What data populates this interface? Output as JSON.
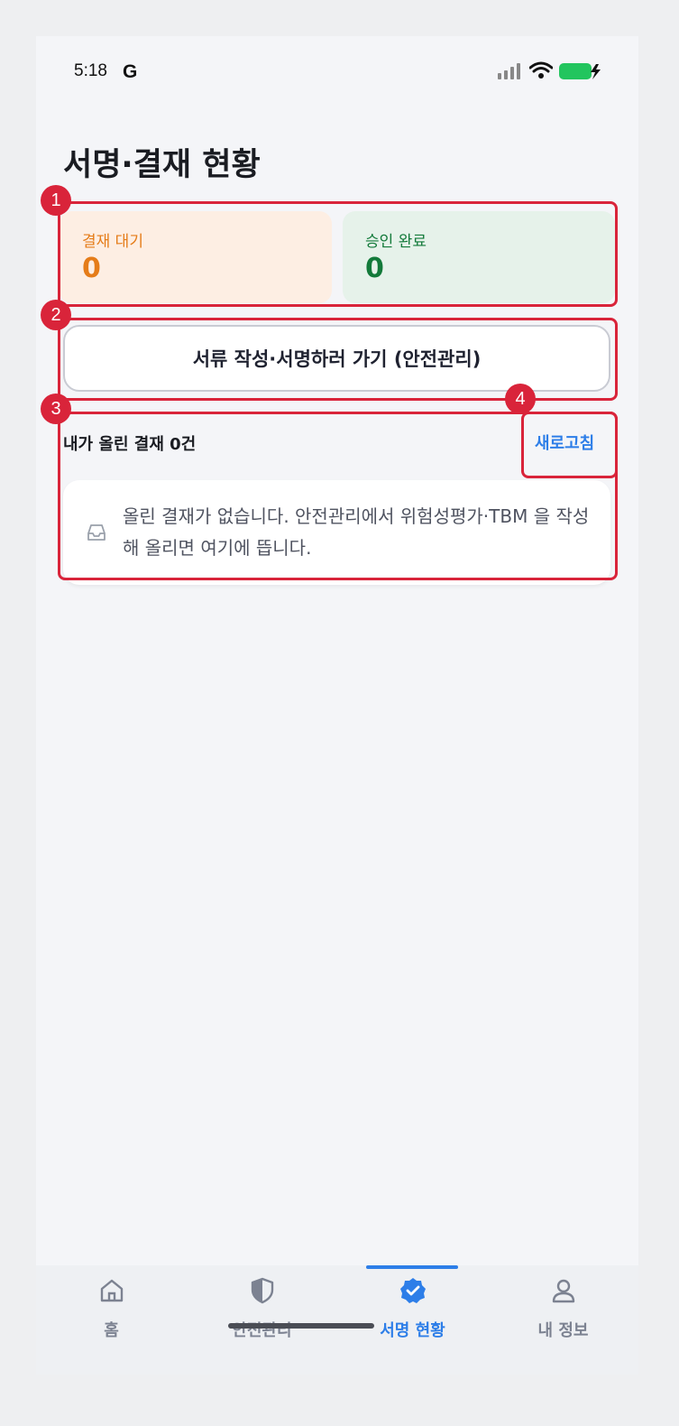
{
  "status_bar": {
    "time": "5:18",
    "carrier_logo": "G",
    "icons": [
      "signal-icon",
      "wifi-icon",
      "battery-charging-icon"
    ],
    "battery_color": "#22c55e"
  },
  "page": {
    "title": "서명·결재 현황"
  },
  "summary": {
    "pending": {
      "label": "결재 대기",
      "count": "0",
      "color": "#e57c19"
    },
    "approved": {
      "label": "승인 완료",
      "count": "0",
      "color": "#137a3a"
    }
  },
  "go_button": {
    "label": "서류 작성·서명하러 가기 (안전관리)"
  },
  "list": {
    "title": "내가 올린 결재 0건",
    "refresh_label": "새로고침",
    "empty_icon": "inbox-icon",
    "empty_text": "올린 결재가 없습니다. 안전관리에서 위험성평가·TBM 을 작성해 올리면 여기에 뜹니다."
  },
  "annotations": [
    "1",
    "2",
    "3",
    "4"
  ],
  "bottom_nav": {
    "accent": "#2d7ee8",
    "active_index": 2,
    "items": [
      {
        "label": "홈",
        "icon": "home-icon"
      },
      {
        "label": "안전관리",
        "icon": "shield-icon"
      },
      {
        "label": "서명 현황",
        "icon": "verified-badge-icon"
      },
      {
        "label": "내 정보",
        "icon": "user-icon"
      }
    ]
  }
}
